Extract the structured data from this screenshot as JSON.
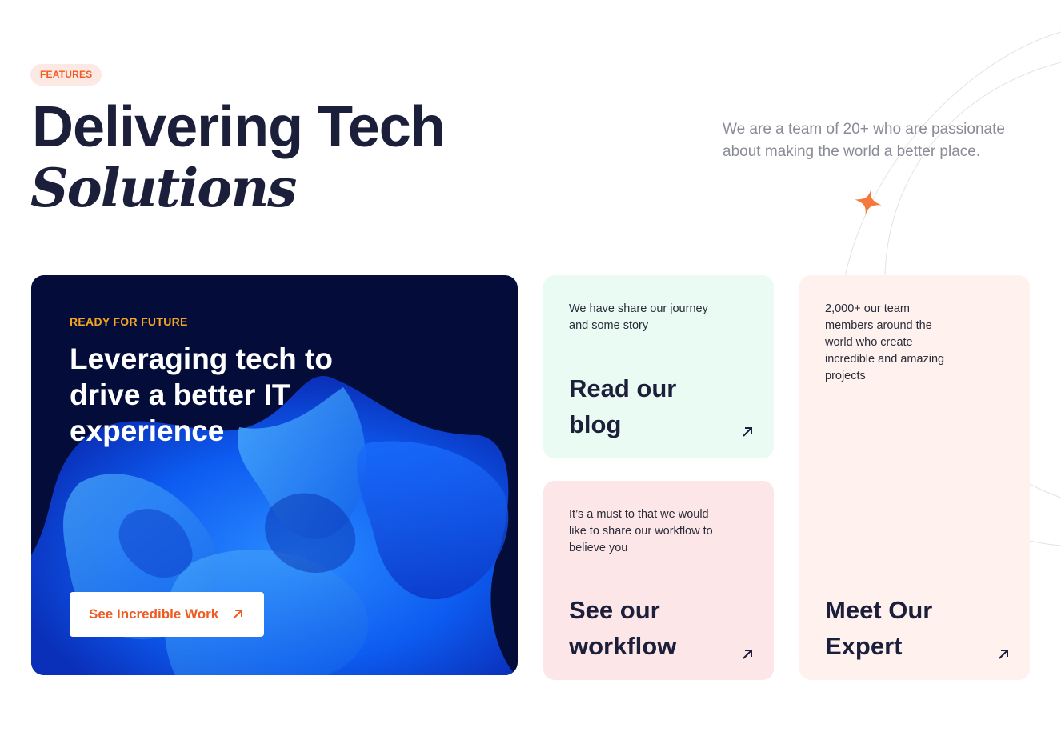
{
  "header": {
    "tag": "FEATURES",
    "title_main": "Delivering Tech",
    "title_italic": "Solutions",
    "intro": "We are a team of 20+ who are passionate about making the world a better place."
  },
  "hero": {
    "eyebrow": "READY FOR FUTURE",
    "headline": "Leveraging tech to drive a better IT experience",
    "cta_label": "See Incredible Work",
    "cta_icon": "arrow-up-right-icon"
  },
  "cards": {
    "blog": {
      "description": "We have share our journey and some story",
      "title": "Read our blog",
      "icon": "arrow-up-right-icon"
    },
    "workflow": {
      "description": "It’s a must to that we would like to share our workflow to believe you",
      "title": "See our workflow",
      "icon": "arrow-up-right-icon"
    },
    "expert": {
      "description": "2,000+ our team members around the world who create incredible and amazing projects",
      "title": "Meet Our Expert",
      "icon": "arrow-up-right-icon"
    }
  },
  "colors": {
    "accent": "#f05a23",
    "eyebrow": "#f5a623",
    "dark": "#1c1f3a",
    "hero_bg": "#040c3a",
    "blog_bg": "#e9fbf3",
    "workflow_bg": "#fde6e7",
    "expert_bg": "#fef1ee"
  }
}
